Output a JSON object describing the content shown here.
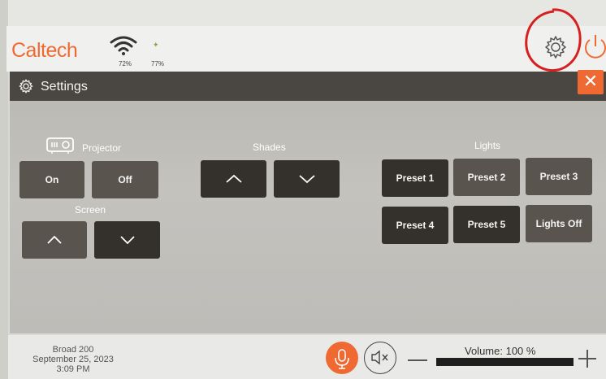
{
  "brand": {
    "logo_text": "Caltech",
    "accent": "#ef6a32"
  },
  "status": {
    "wifi_pct": "72%",
    "signal_pct": "77%"
  },
  "settings": {
    "title": "Settings",
    "close_label": "✕"
  },
  "projector": {
    "label": "Projector",
    "on": "On",
    "off": "Off"
  },
  "screen": {
    "label": "Screen"
  },
  "shades": {
    "label": "Shades"
  },
  "lights": {
    "label": "Lights",
    "presets": [
      "Preset 1",
      "Preset 2",
      "Preset 3",
      "Preset 4",
      "Preset 5",
      "Lights Off"
    ]
  },
  "footer": {
    "room": "Broad 200",
    "date": "September 25, 2023",
    "time": "3:09 PM",
    "volume_label": "Volume: 100 %",
    "volume_pct": 100
  },
  "icons": [
    "wifi-icon",
    "signal-icon",
    "gear-icon",
    "power-icon",
    "projector-icon",
    "arrow-up-icon",
    "arrow-down-icon",
    "mic-icon",
    "mute-icon",
    "minus-icon",
    "plus-icon"
  ]
}
